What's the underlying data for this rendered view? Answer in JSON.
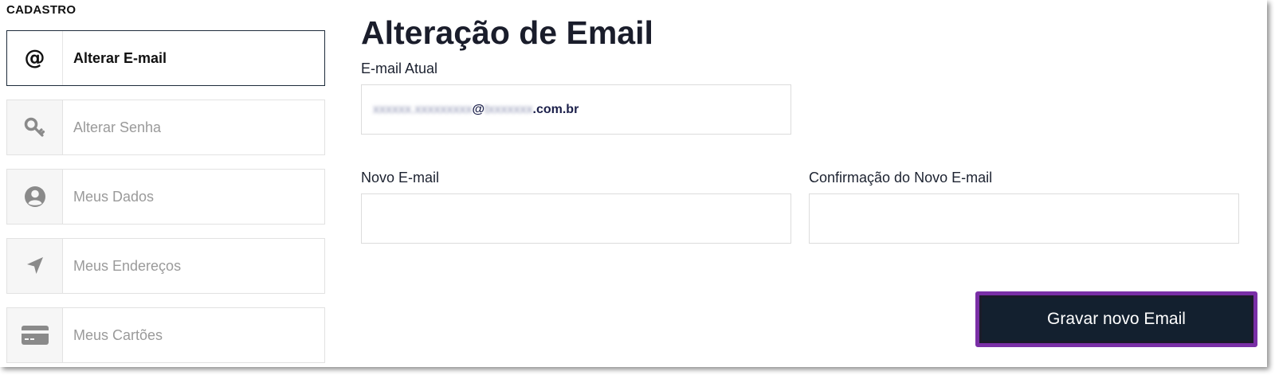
{
  "sidebar": {
    "heading": "CADASTRO",
    "items": [
      {
        "label": "Alterar E-mail",
        "icon": "at-icon",
        "active": true
      },
      {
        "label": "Alterar Senha",
        "icon": "key-icon",
        "active": false
      },
      {
        "label": "Meus Dados",
        "icon": "user-icon",
        "active": false
      },
      {
        "label": "Meus Endereços",
        "icon": "location-arrow-icon",
        "active": false
      },
      {
        "label": "Meus Cartões",
        "icon": "credit-card-icon",
        "active": false
      }
    ]
  },
  "main": {
    "title": "Alteração de Email",
    "current_email": {
      "label": "E-mail Atual",
      "value_blurred_user": "xxxxxx.xxxxxxxxx",
      "value_at": "@",
      "value_blurred_domain": "txxxxxxx",
      "value_suffix": ".com.br"
    },
    "new_email": {
      "label": "Novo E-mail",
      "value": "",
      "placeholder": ""
    },
    "confirm_email": {
      "label": "Confirmação do Novo E-mail",
      "value": "",
      "placeholder": ""
    },
    "save_label": "Gravar novo Email"
  },
  "colors": {
    "button_bg": "#13202f",
    "button_border": "#7a2fa6",
    "active_border": "#1d2b3a",
    "inactive_text": "#9a9a9a"
  }
}
